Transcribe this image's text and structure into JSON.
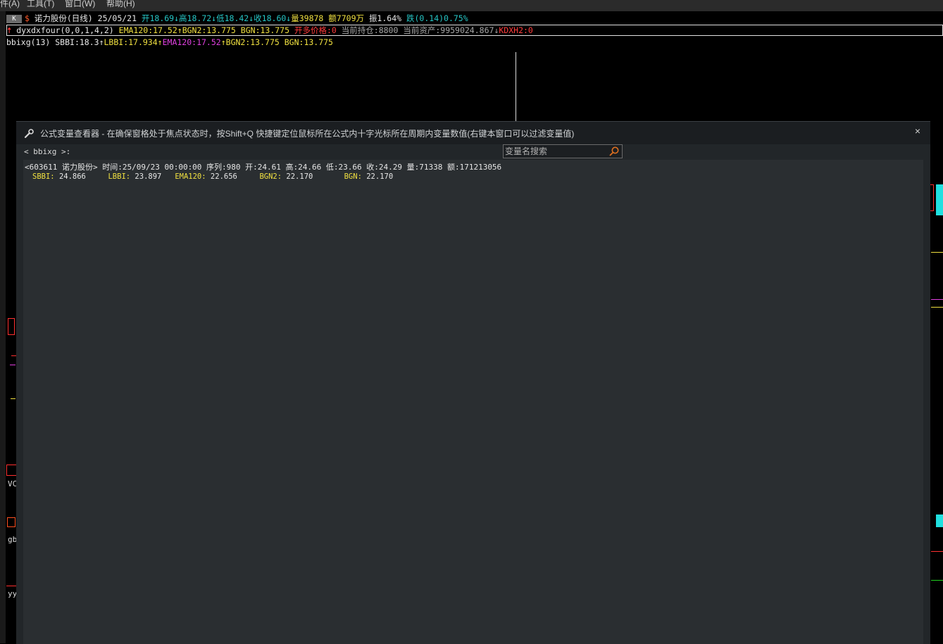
{
  "menubar": {
    "items": [
      "件(A)",
      "工具(T)",
      "窗口(W)",
      "帮助(H)"
    ]
  },
  "quote": {
    "k_label": "K",
    "marker": "$",
    "title": "诺力股份(日线) 25/05/21",
    "open": "开18.69",
    "high": "高18.72",
    "low": "低18.42",
    "close": "收18.60",
    "volume": "量39878",
    "amount": "额7709万",
    "amplitude": "振1.64%",
    "change": "跌(0.14)0.75%"
  },
  "indicator1": {
    "name": "dyxdxfour(0,0,1,4,2)",
    "ema": "EMA120:17.52",
    "bgn2": "BGN2:13.775",
    "bgn": "BGN:13.775",
    "open_price": "开多价格:0",
    "position": "当前持仓:8800",
    "assets": "当前资产:9959024.867",
    "kdxh2": "KDXH2:0"
  },
  "indicator2": {
    "name": "bbixg(13)",
    "sbbi": "SBBI:18.3",
    "lbbi": "LBBI:17.934",
    "ema": "EMA120:17.52",
    "bgn2": "BGN2:13.775",
    "bgn": "BGN:13.775"
  },
  "side_labels": [
    "VC",
    "gb",
    "yy"
  ],
  "dialog": {
    "title": "公式变量查看器 - 在确保窗格处于焦点状态时，按Shift+Q 快捷键定位鼠标所在公式内十字光标所在周期内变量数值(右键本窗口可以过滤变量值)",
    "close": "×",
    "formula": "< bbixg >:",
    "search_placeholder": "变量名搜索",
    "info": "<603611 诺力股份> 时间:25/09/23 00:00:00 序列:980 开:24.61 高:24.66 低:23.66 收:24.29 量:71338 额:171213056",
    "vars": [
      {
        "name": "SBBI:",
        "value": "24.866"
      },
      {
        "name": "LBBI:",
        "value": "23.897"
      },
      {
        "name": "EMA120:",
        "value": "22.656"
      },
      {
        "name": "BGN2:",
        "value": "22.170"
      },
      {
        "name": "BGN:",
        "value": "22.170"
      }
    ]
  }
}
